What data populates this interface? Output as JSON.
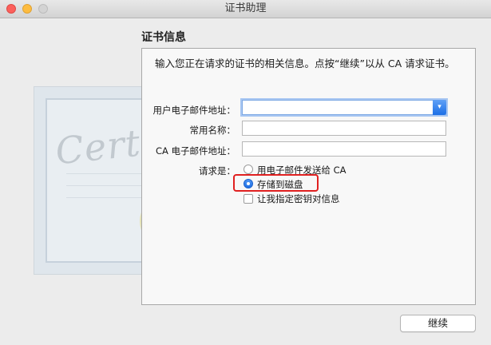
{
  "window": {
    "title": "证书助理"
  },
  "heading": "证书信息",
  "description": "输入您正在请求的证书的相关信息。点按“继续”以从 CA 请求证书。",
  "form": {
    "user_email_label": "用户电子邮件地址：",
    "user_email_value": "",
    "common_name_label": "常用名称：",
    "common_name_value": "",
    "ca_email_label": "CA 电子邮件地址：",
    "ca_email_value": "",
    "request_label": "请求是：",
    "options": [
      {
        "label": "用电子邮件发送给 CA",
        "checked": false
      },
      {
        "label": "存储到磁盘",
        "checked": true
      }
    ],
    "specify_key_label": "让我指定密钥对信息",
    "specify_key_checked": false
  },
  "buttons": {
    "continue_label": "继续"
  },
  "background": {
    "certificate_text": "Certificate"
  },
  "colors": {
    "accent": "#1f6fe4",
    "highlight": "#e02020"
  }
}
